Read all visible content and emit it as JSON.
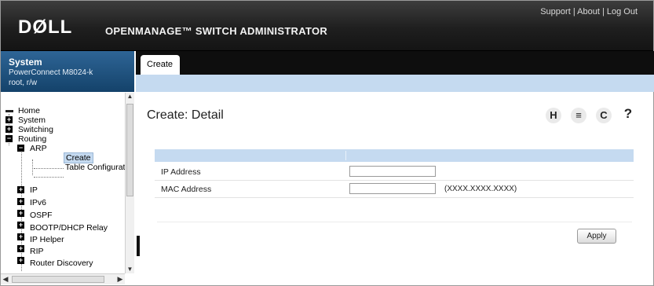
{
  "header": {
    "logo": "DØLL",
    "product": "OPENMANAGE™ SWITCH ADMINISTRATOR",
    "links": [
      "Support",
      "About",
      "Log Out"
    ],
    "link_sep": "|"
  },
  "system": {
    "title": "System",
    "model": "PowerConnect M8024-k",
    "user": "root, r/w"
  },
  "tabs": [
    {
      "label": "Create",
      "active": true
    }
  ],
  "nav": {
    "items": [
      {
        "label": "Home",
        "level": 0,
        "toggle": "none"
      },
      {
        "label": "System",
        "level": 0,
        "toggle": "+"
      },
      {
        "label": "Switching",
        "level": 0,
        "toggle": "+"
      },
      {
        "label": "Routing",
        "level": 0,
        "toggle": "-"
      },
      {
        "label": "ARP",
        "level": 1,
        "toggle": "-"
      },
      {
        "label": "Create",
        "level": 2,
        "toggle": "none",
        "selected": true
      },
      {
        "label": "Table Configurat",
        "level": 2,
        "toggle": "none"
      },
      {
        "label": "IP",
        "level": 1,
        "toggle": "+"
      },
      {
        "label": "IPv6",
        "level": 1,
        "toggle": "+"
      },
      {
        "label": "OSPF",
        "level": 1,
        "toggle": "+"
      },
      {
        "label": "BOOTP/DHCP Relay",
        "level": 1,
        "toggle": "+"
      },
      {
        "label": "IP Helper",
        "level": 1,
        "toggle": "+"
      },
      {
        "label": "RIP",
        "level": 1,
        "toggle": "+"
      },
      {
        "label": "Router Discovery",
        "level": 1,
        "toggle": "+"
      }
    ]
  },
  "content": {
    "title": "Create: Detail",
    "toolbar_icons": [
      {
        "name": "save-icon",
        "glyph": "H"
      },
      {
        "name": "print-icon",
        "glyph": "≡"
      },
      {
        "name": "refresh-icon",
        "glyph": "C"
      },
      {
        "name": "help-icon",
        "glyph": "?"
      }
    ],
    "form": {
      "ip_label": "IP Address",
      "ip_value": "",
      "mac_label": "MAC Address",
      "mac_value": "",
      "mac_hint": "(XXXX.XXXX.XXXX)"
    },
    "apply_label": "Apply"
  }
}
